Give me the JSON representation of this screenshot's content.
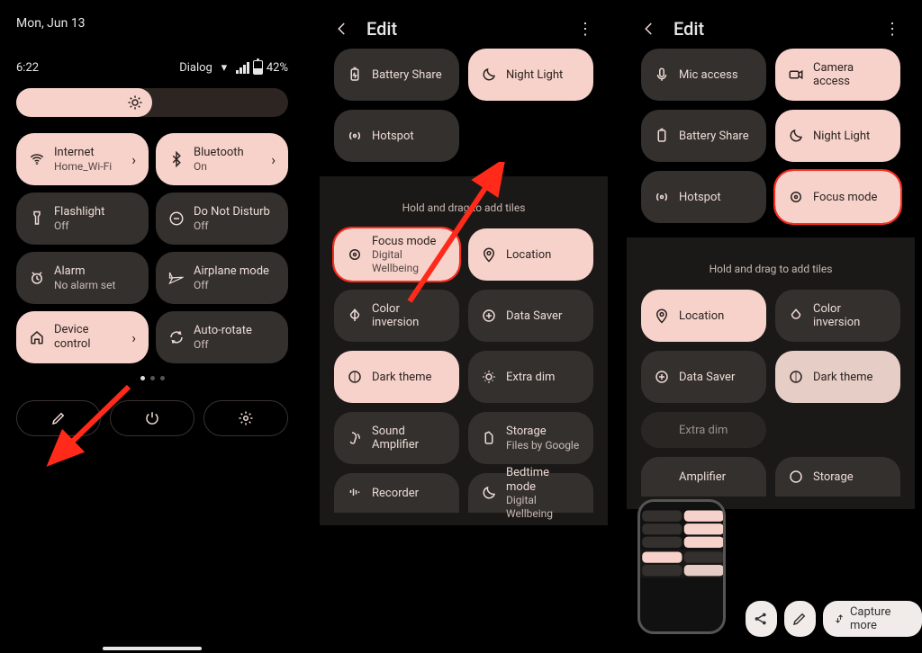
{
  "qs": {
    "date": "Mon, Jun 13",
    "clock": "6:22",
    "carrier": "Dialog",
    "battery_pct": "42%",
    "brightness_pct": 50,
    "tiles": {
      "internet": {
        "label": "Internet",
        "sub": "Home_Wi-Fi"
      },
      "bluetooth": {
        "label": "Bluetooth",
        "sub": "On"
      },
      "flashlight": {
        "label": "Flashlight",
        "sub": "Off"
      },
      "dnd": {
        "label": "Do Not Disturb",
        "sub": "Off"
      },
      "alarm": {
        "label": "Alarm",
        "sub": "No alarm set"
      },
      "airplane": {
        "label": "Airplane mode",
        "sub": "Off"
      },
      "devicectl": {
        "label": "Device control"
      },
      "autorotate": {
        "label": "Auto-rotate",
        "sub": "Off"
      }
    }
  },
  "edit2": {
    "title": "Edit",
    "active": {
      "battery_share": "Battery Share",
      "night_light": "Night Light",
      "hotspot": "Hotspot"
    },
    "hint": "Hold and drag to add tiles",
    "available": {
      "focus": {
        "label": "Focus mode",
        "sub": "Digital Wellbeing"
      },
      "location": "Location",
      "color_inv": "Color inversion",
      "data_saver": "Data Saver",
      "dark_theme": "Dark theme",
      "extra_dim": "Extra dim",
      "sound_amp": "Sound Amplifier",
      "storage": {
        "label": "Storage",
        "sub": "Files by Google"
      },
      "recorder": "Recorder",
      "bedtime": {
        "label": "Bedtime mode",
        "sub": "Digital Wellbeing"
      }
    }
  },
  "edit3": {
    "title": "Edit",
    "active": {
      "mic": "Mic access",
      "camera": "Camera access",
      "battery_share": "Battery Share",
      "night_light": "Night Light",
      "hotspot": "Hotspot",
      "focus": "Focus mode"
    },
    "hint": "Hold and drag to add tiles",
    "available": {
      "location": "Location",
      "color_inv": "Color inversion",
      "data_saver": "Data Saver",
      "dark_theme": "Dark theme",
      "extra_dim": "Extra dim",
      "amplifier": "Amplifier",
      "storage": "Storage"
    },
    "capture_more": "Capture more"
  },
  "colors": {
    "accent": "#f7d2cb",
    "tile_dark": "#33302e",
    "danger": "#ff2a1a"
  }
}
